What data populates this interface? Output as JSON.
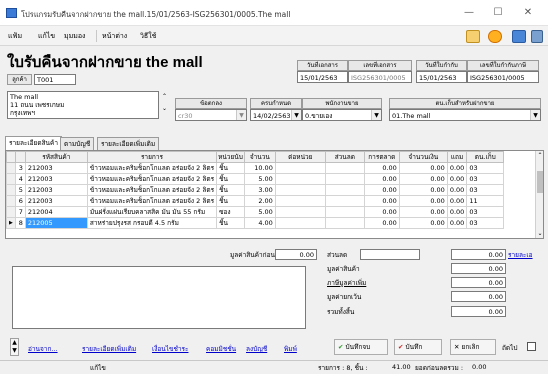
{
  "window": {
    "title": "โปรแกรมรับคืนจากฝากขาย the mall.15/01/2563-ISG256301/0005.The mall",
    "min": "—",
    "max": "☐",
    "close": "✕"
  },
  "menu": [
    "แฟ้ม",
    "แก้ไข",
    "มุมมอง",
    "หน้าต่าง",
    "วิธีใช้"
  ],
  "toolbar_icons": [
    {
      "name": "pencil-icon",
      "color": "#e0a020"
    },
    {
      "name": "help-icon",
      "color": "#f08000"
    },
    {
      "name": "monitor-icon",
      "color": "#3a6fc8"
    },
    {
      "name": "document-icon",
      "color": "#5a80b8"
    }
  ],
  "header": {
    "title": "ใบรับคืนจากฝากขาย the mall"
  },
  "doc": {
    "col1_label": "วันที่เอกสาร",
    "col1_value": "15/01/2563",
    "col2_label": "เลขที่เอกสาร",
    "col2_value": "ISG256301/0005",
    "col3_label": "วันที่ใบกำกับ",
    "col3_value": "15/01/2563",
    "col4_label": "เลขที่ใบกำกับภาษี",
    "col4_value": "ISG256301/0005"
  },
  "customer": {
    "label": "ลูกค้า",
    "value": "T001",
    "address": [
      "The mall",
      "11 ถนน เพชรเกษม",
      "กรุงเทพฯ"
    ]
  },
  "terms": {
    "label": "ข้อตกลง",
    "value": "cr30"
  },
  "due": {
    "label": "ครบกำหนด",
    "value": "14/02/2563"
  },
  "employee": {
    "label": "พนักงานขาย",
    "value": "0.ขายเอง"
  },
  "location": {
    "label": "ตน.เก็บสำหรับฝากขาย",
    "value": "01.The mall"
  },
  "tabs": [
    "รายละเอียดสินค้า",
    "ตามบัญชี",
    "รายละเอียดเพิ่มเติม"
  ],
  "grid": {
    "columns": [
      "",
      "",
      "รหัสสินค้า",
      "รายการ",
      "หน่วยนับ",
      "จำนวน",
      "ต่อหน่วย",
      "ส่วนลด",
      "การตลาด",
      "จำนวนเงิน",
      "แถม",
      "ตน.เก็บ"
    ],
    "rows": [
      {
        "no": "3",
        "code": "212003",
        "desc": "ข้าวหอมและคริมช็อกโกแลต อร่อยจัง 2 ลิตร",
        "unit": "ชิ้น",
        "qty": "10.00",
        "price": "",
        "disc": "",
        "mkt": "0.00",
        "amount": "0.00",
        "free": "0.00",
        "loc": "03"
      },
      {
        "no": "4",
        "code": "212003",
        "desc": "ข้าวหอมและคริมช็อกโกแลต อร่อยจัง 2 ลิตร",
        "unit": "ชิ้น",
        "qty": "5.00",
        "price": "",
        "disc": "",
        "mkt": "0.00",
        "amount": "0.00",
        "free": "0.00",
        "loc": "03"
      },
      {
        "no": "5",
        "code": "212003",
        "desc": "ข้าวหอมและคริมช็อกโกแลต อร่อยจัง 2 ลิตร",
        "unit": "ชิ้น",
        "qty": "3.00",
        "price": "",
        "disc": "",
        "mkt": "0.00",
        "amount": "0.00",
        "free": "0.00",
        "loc": "03"
      },
      {
        "no": "6",
        "code": "212003",
        "desc": "ข้าวหอมและคริมช็อกโกแลต อร่อยจัง 2 ลิตร",
        "unit": "ชิ้น",
        "qty": "2.00",
        "price": "",
        "disc": "",
        "mkt": "0.00",
        "amount": "0.00",
        "free": "0.00",
        "loc": "11"
      },
      {
        "no": "7",
        "code": "212004",
        "desc": "มันฝรั่งแผ่นเรียบคลาสสิค มัน มัน 55 กรัม",
        "unit": "ซอง",
        "qty": "5.00",
        "price": "",
        "disc": "",
        "mkt": "0.00",
        "amount": "0.00",
        "free": "0.00",
        "loc": "03"
      },
      {
        "no": "8",
        "code": "212005",
        "desc": "สาหร่ายปรุงรส กรอบดี 4.5 กรัม",
        "unit": "ชิ้น",
        "qty": "4.00",
        "price": "",
        "disc": "",
        "mkt": "0.00",
        "amount": "0.00",
        "free": "0.00",
        "loc": "03"
      }
    ]
  },
  "totals": {
    "before_disc_label": "มูลค่าสินค้าก่อนลด",
    "before_disc_value": "0.00",
    "discount_label": "ส่วนลด",
    "discount_value": "0.00",
    "discount_link": "รายละเอ",
    "goods_label": "มูลค่าสินค้า",
    "goods_value": "0.00",
    "vat_label": "ภาษีมูลค่าเพิ่ม",
    "vat_value": "0.00",
    "except_label": "มูลค่ายกเว้น",
    "except_value": "0.00",
    "total_label": "รวมทั้งสิ้น",
    "total_value": "0.00"
  },
  "bottom_links": [
    "อ่านจาก...",
    "รายละเอียดเพิ่มเติม",
    "เงื่อนไขชำระ",
    "คอมมิชชั่น",
    "ลงบัญชี",
    "พิมพ์"
  ],
  "buttons": {
    "save": "บันทึกจบ",
    "save2": "บันทึก",
    "cancel": "ยกเลิก",
    "next": "ถัดไป"
  },
  "status": {
    "mode": "แก้ไข",
    "summary": "รายการ : 8, ชิ้น :",
    "qty_total": "41.00",
    "balance_label": "ยอดก่อนลดรวม :",
    "balance_value": "0.00"
  }
}
